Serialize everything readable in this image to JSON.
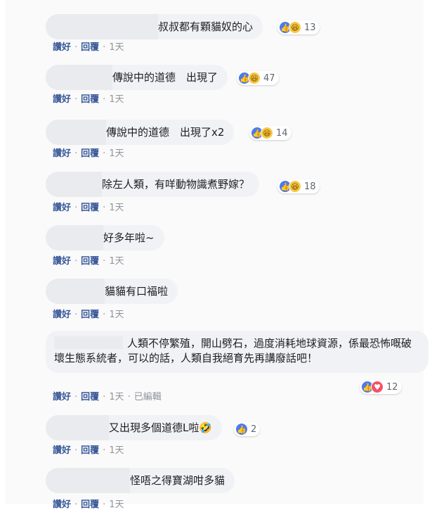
{
  "actions": {
    "like": "讚好",
    "reply": "回覆",
    "sep": "·",
    "edited": "已編輯"
  },
  "comments": [
    {
      "text": "叔叔都有顆貓奴的心",
      "reactions": [
        "like",
        "haha"
      ],
      "count": "13",
      "time": "1天"
    },
    {
      "text": "傳說中的道德　出現了",
      "reactions": [
        "like",
        "haha"
      ],
      "count": "47",
      "time": "1天"
    },
    {
      "text": "傳說中的道德　出現了x2",
      "reactions": [
        "like",
        "haha"
      ],
      "count": "14",
      "time": "1天"
    },
    {
      "text": "除左人類，有咩動物識煮野嫁？",
      "reactions": [
        "like",
        "haha"
      ],
      "count": "18",
      "time": "1天"
    },
    {
      "text": "好多年啦~",
      "time": "1天"
    },
    {
      "text": "貓貓有口福啦",
      "time": "1天"
    },
    {
      "text": "人類不停繁殖，開山劈石，過度消耗地球資源，係最恐怖嘅破壞生態系統者，可以的話，人類自我絕育先再講廢話吧！",
      "reactions": [
        "like",
        "love"
      ],
      "count": "12",
      "time": "1天",
      "edited": true
    },
    {
      "text": "又出現多個道德L啦🤣",
      "reactions": [
        "like"
      ],
      "count": "2",
      "time": "1天"
    },
    {
      "text": "怪唔之得寶湖咁多貓",
      "time": "1天"
    }
  ],
  "icons": {
    "like": "thumbs-up-icon",
    "haha": "laughing-face-icon",
    "love": "heart-icon"
  },
  "colors": {
    "bubble": "#f1f2f6",
    "link": "#385898",
    "meta": "#90949c",
    "like": "#4b7bec",
    "haha": "#f7c842",
    "love": "#f25268"
  }
}
